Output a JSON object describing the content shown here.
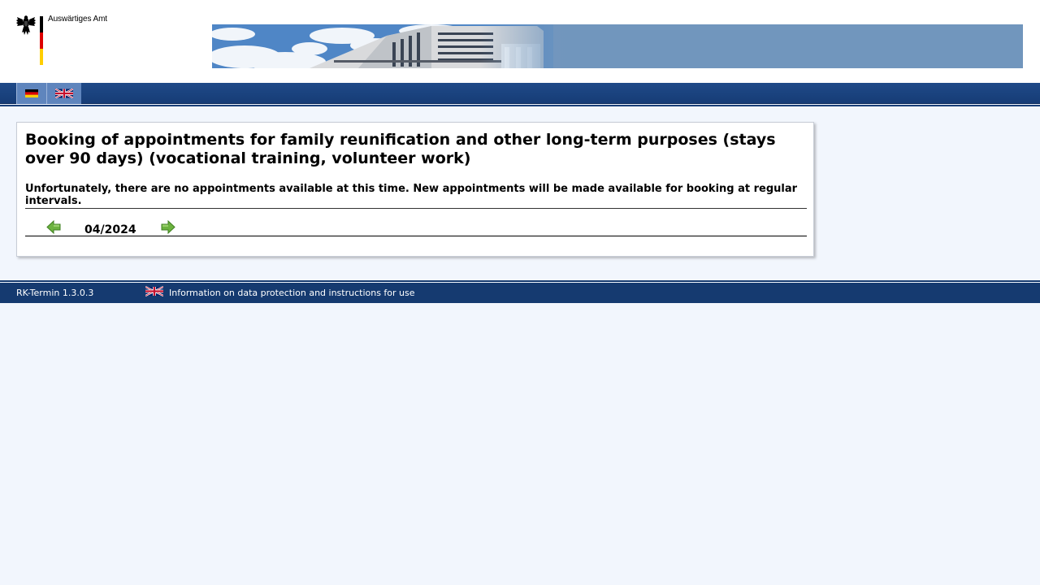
{
  "header": {
    "ministry_name": "Auswärtiges Amt",
    "logo_icon": "federal-eagle-icon",
    "banner_icon": "building-banner-image"
  },
  "language_bar": {
    "languages": [
      {
        "code": "de",
        "icon": "german-flag-icon"
      },
      {
        "code": "en",
        "icon": "uk-flag-icon"
      }
    ]
  },
  "main": {
    "title": "Booking of appointments for family reunification and other long-term purposes (stays over 90 days) (vocational training, volunteer work)",
    "message": "Unfortunately, there are no appointments available at this time. New appointments will be made available for booking at regular intervals.",
    "month": "04/2024",
    "prev_icon": "arrow-left-icon",
    "next_icon": "arrow-right-icon"
  },
  "footer": {
    "version": "RK-Termin 1.3.0.3",
    "link_label": "Information on data protection and instructions for use",
    "link_icon": "uk-flag-icon"
  },
  "colors": {
    "page_background": "#f2f6fd",
    "bar_blue": "#163c76",
    "tab_blue": "#5f85bd",
    "arrow_green": "#6cb33f"
  }
}
